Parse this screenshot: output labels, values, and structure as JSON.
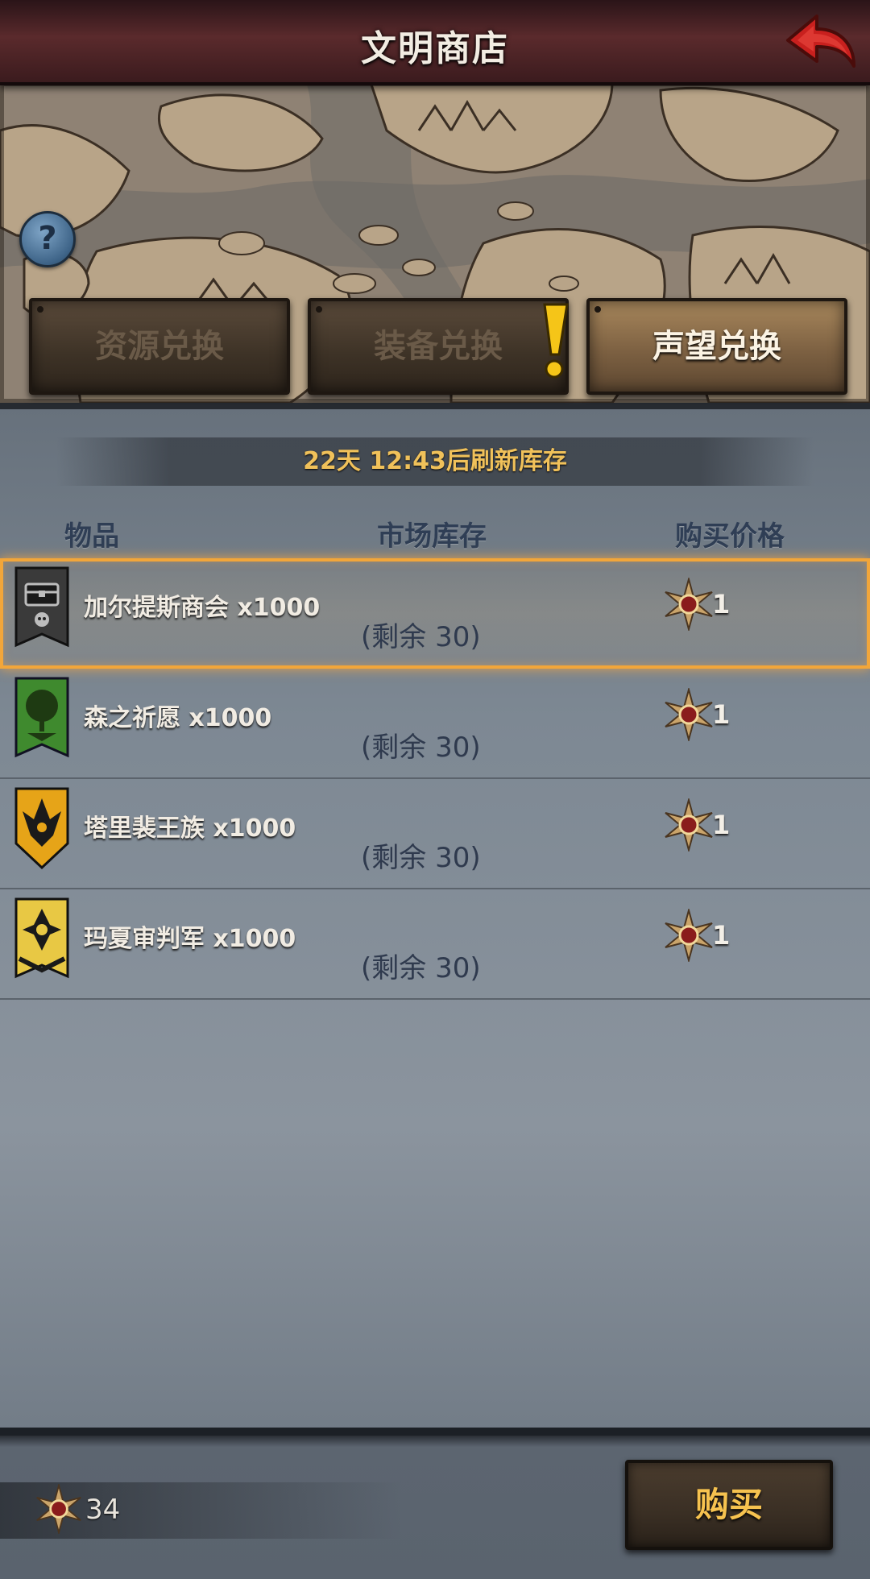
{
  "header": {
    "title": "文明商店",
    "back_icon": "back-arrow-icon",
    "back_color": "#c8201e"
  },
  "help": {
    "label": "?"
  },
  "tabs": [
    {
      "label": "资源兑换",
      "active": false
    },
    {
      "label": "装备兑换",
      "active": false,
      "alert": "!"
    },
    {
      "label": "声望兑换",
      "active": true
    }
  ],
  "refresh": {
    "text": "22天 12:43后刷新库存"
  },
  "columns": {
    "item": "物品",
    "stock": "市场库存",
    "price": "购买价格"
  },
  "items": [
    {
      "name": "加尔提斯商会 x1000",
      "stock": "(剩余 30)",
      "price": "1",
      "banner": "chest-banner-icon",
      "selected": true
    },
    {
      "name": "森之祈愿 x1000",
      "stock": "(剩余 30)",
      "price": "1",
      "banner": "tree-banner-icon",
      "selected": false
    },
    {
      "name": "塔里裴王族 x1000",
      "stock": "(剩余 30)",
      "price": "1",
      "banner": "dragon-banner-icon",
      "selected": false
    },
    {
      "name": "玛夏审判军 x1000",
      "stock": "(剩余 30)",
      "price": "1",
      "banner": "cross-banner-icon",
      "selected": false
    }
  ],
  "footer": {
    "balance": "34",
    "currency_icon": "reputation-star-icon",
    "buy_label": "购买"
  },
  "colors": {
    "accent_gold": "#f2a63a",
    "refresh_text": "#f0c15a",
    "buy_text": "#f6c24f"
  }
}
